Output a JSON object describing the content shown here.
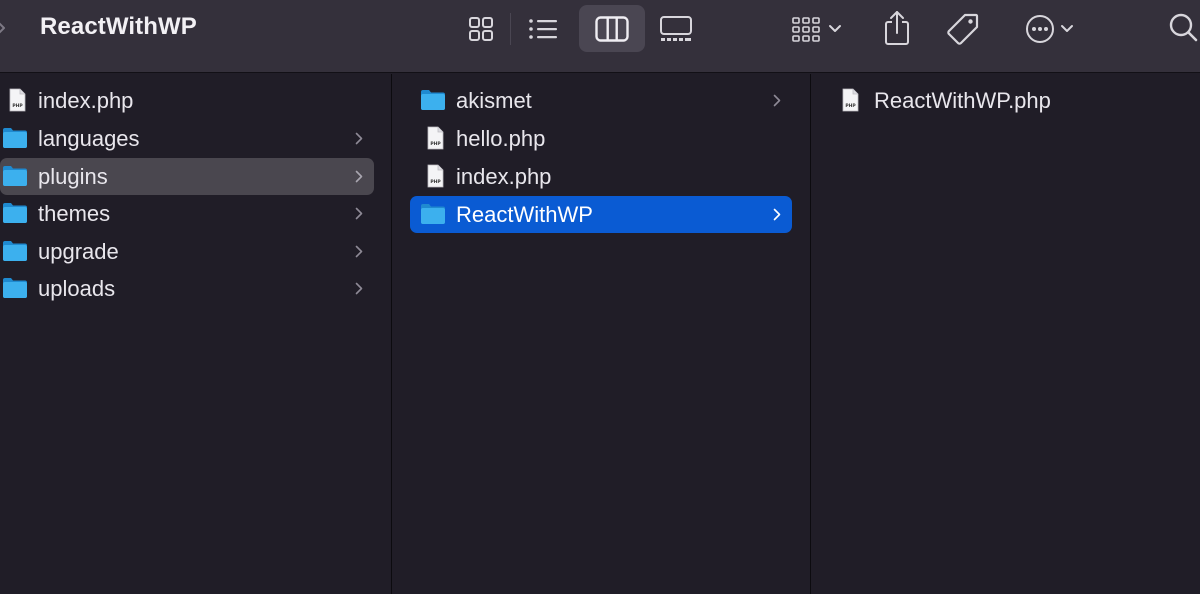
{
  "window": {
    "title": "ReactWithWP"
  },
  "toolbar": {
    "view_modes": [
      "icon-view",
      "list-view",
      "column-view",
      "gallery-view"
    ],
    "selected_view": "column-view",
    "actions": [
      "group-by",
      "share",
      "tags",
      "more-actions",
      "search"
    ]
  },
  "columns": [
    {
      "items": [
        {
          "label": "index.php",
          "type": "file"
        },
        {
          "label": "languages",
          "type": "folder"
        },
        {
          "label": "plugins",
          "type": "folder",
          "selected": "inactive"
        },
        {
          "label": "themes",
          "type": "folder"
        },
        {
          "label": "upgrade",
          "type": "folder"
        },
        {
          "label": "uploads",
          "type": "folder"
        }
      ]
    },
    {
      "items": [
        {
          "label": "akismet",
          "type": "folder"
        },
        {
          "label": "hello.php",
          "type": "file"
        },
        {
          "label": "index.php",
          "type": "file"
        },
        {
          "label": "ReactWithWP",
          "type": "folder",
          "selected": "active"
        }
      ]
    },
    {
      "items": [
        {
          "label": "ReactWithWP.php",
          "type": "file"
        }
      ]
    }
  ],
  "colors": {
    "toolbar_bg": "#34303b",
    "content_bg": "#201d27",
    "selection_active": "#0a5bd3",
    "selection_inactive": "#4a474f",
    "folder_blue": "#38a9ea"
  }
}
